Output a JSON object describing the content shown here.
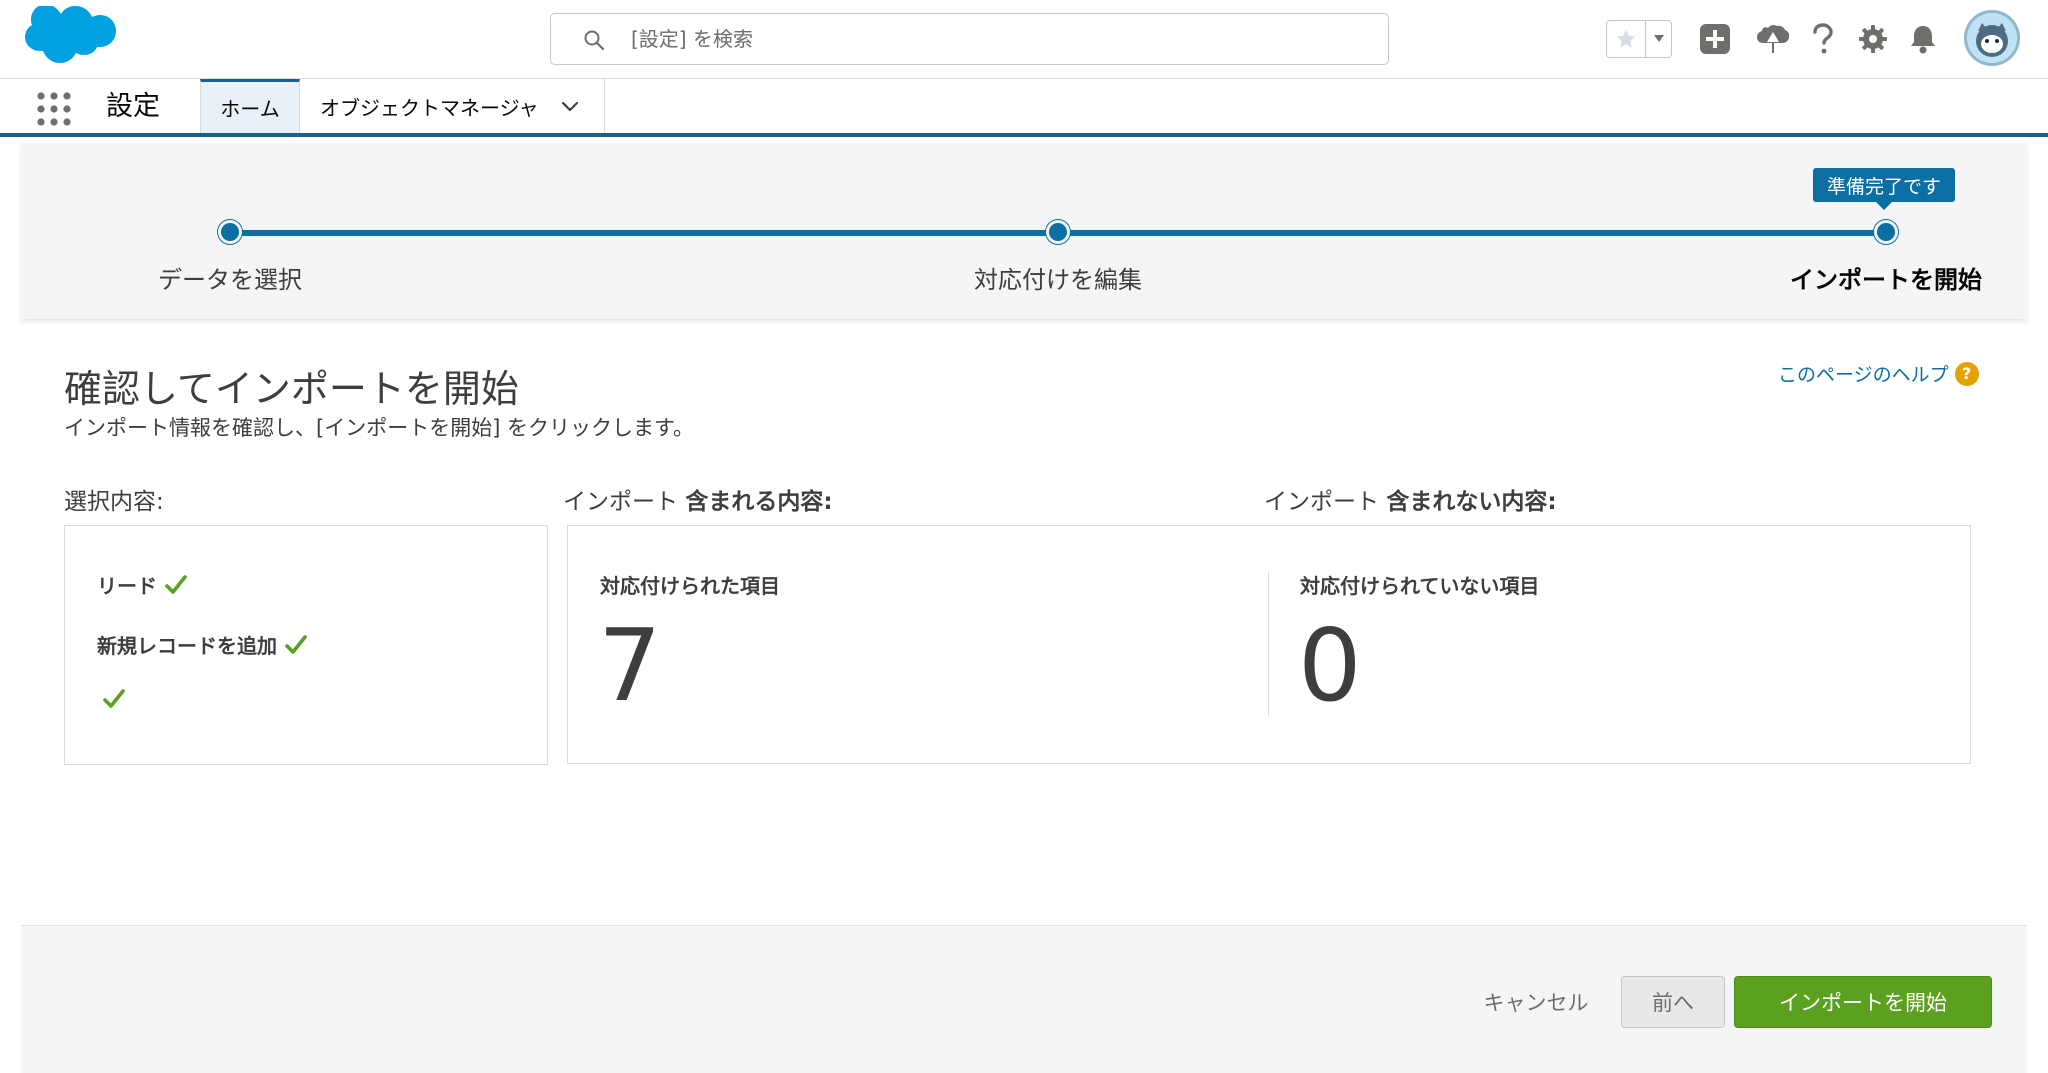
{
  "header": {
    "search_placeholder": "[設定] を検索"
  },
  "app_nav": {
    "app_name": "設定",
    "tabs": [
      {
        "label": "ホーム"
      },
      {
        "label": "オブジェクトマネージャ"
      }
    ]
  },
  "progress": {
    "steps": [
      {
        "label": "データを選択"
      },
      {
        "label": "対応付けを編集"
      },
      {
        "label": "インポートを開始"
      }
    ],
    "tooltip": "準備完了です"
  },
  "page": {
    "title": "確認してインポートを開始",
    "subtitle": "インポート情報を確認し、[インポートを開始] をクリックします。",
    "help_link": "このページのヘルプ",
    "help_icon_glyph": "?"
  },
  "sections": {
    "selection_label": "選択内容:",
    "included_prefix": "インポート",
    "included_bold": "含まれる内容:",
    "excluded_prefix": "インポート",
    "excluded_bold": "含まれない内容:"
  },
  "selection_items": [
    "リード",
    "新規レコードを追加"
  ],
  "stats": {
    "mapped": {
      "label": "対応付けられた項目",
      "value": "7"
    },
    "unmapped": {
      "label": "対応付けられていない項目",
      "value": "0"
    }
  },
  "footer": {
    "cancel": "キャンセル",
    "prev": "前へ",
    "start": "インポートを開始"
  },
  "colors": {
    "brand_blue": "#0b6fa4",
    "nav_border": "#1b5f8a",
    "check_green": "#4bca81",
    "start_button": "#5ba01e",
    "help_icon": "#e4a201"
  }
}
